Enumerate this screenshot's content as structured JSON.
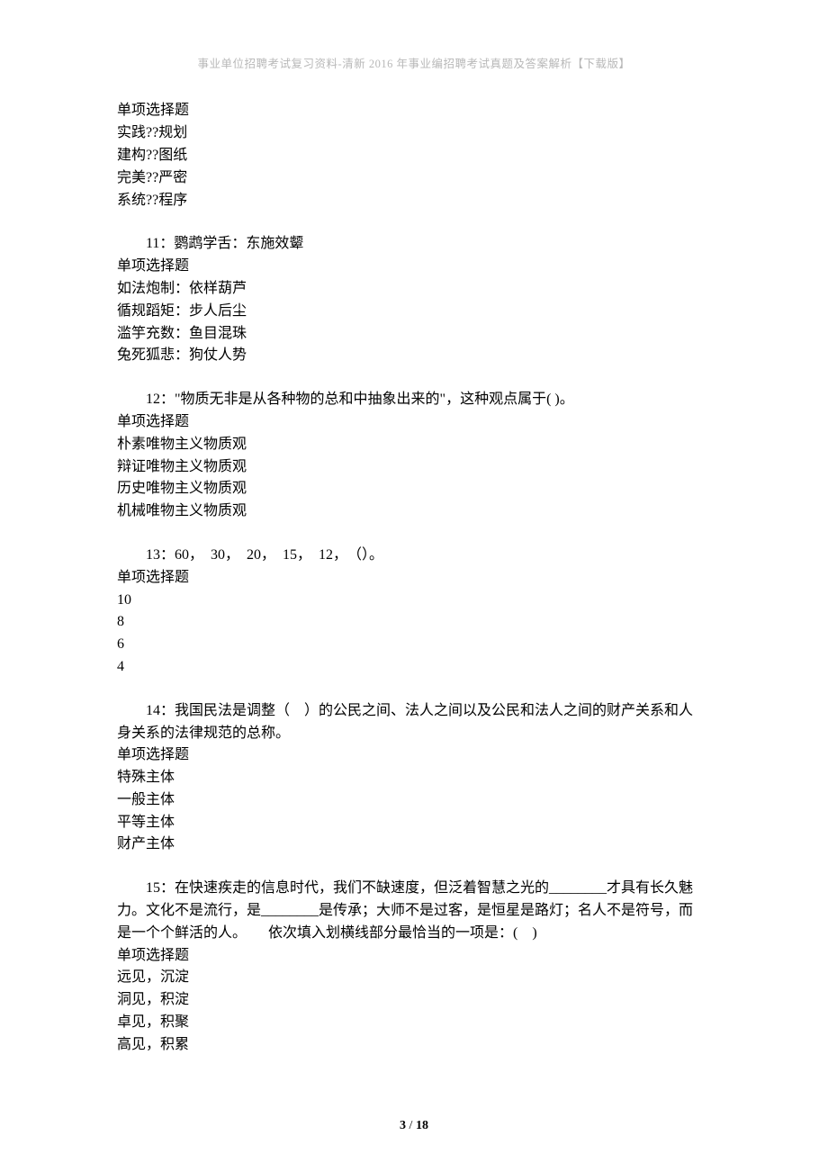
{
  "header": "事业单位招聘考试复习资料-清新 2016 年事业编招聘考试真题及答案解析【下载版】",
  "footer": {
    "current": "3",
    "sep": " / ",
    "total": "18"
  },
  "q10_tail": {
    "qtype": "单项选择题",
    "options": [
      "实践??规划",
      "建构??图纸",
      "完美??严密",
      "系统??程序"
    ]
  },
  "q11": {
    "stem": "11：鹦鹉学舌：东施效颦",
    "qtype": "单项选择题",
    "options": [
      "如法炮制：依样葫芦",
      "循规蹈矩：步人后尘",
      "滥竽充数：鱼目混珠",
      "兔死狐悲：狗仗人势"
    ]
  },
  "q12": {
    "stem": "12：\"物质无非是从各种物的总和中抽象出来的\"，这种观点属于( )。",
    "qtype": "单项选择题",
    "options": [
      "朴素唯物主义物质观",
      "辩证唯物主义物质观",
      "历史唯物主义物质观",
      "机械唯物主义物质观"
    ]
  },
  "q13": {
    "stem": "13：60，　30，　20，　15，　12，　（）。",
    "qtype": "单项选择题",
    "options": [
      "10",
      "8",
      "6",
      "4"
    ]
  },
  "q14": {
    "stem1": "14：我国民法是调整（　）的公民之间、法人之间以及公民和法人之间的财产关系和人",
    "stem2": "身关系的法律规范的总称。",
    "qtype": "单项选择题",
    "options": [
      "特殊主体",
      "一般主体",
      "平等主体",
      "财产主体"
    ]
  },
  "q15": {
    "stem1": "15：在快速疾走的信息时代，我们不缺速度，但泛着智慧之光的________才具有长久魅",
    "stem2": "力。文化不是流行，是________是传承；大师不是过客，是恒星是路灯；名人不是符号，而",
    "stem3": "是一个个鲜活的人。　　依次填入划横线部分最恰当的一项是：(　)",
    "qtype": "单项选择题",
    "options": [
      "远见，沉淀",
      "洞见，积淀",
      "卓见，积聚",
      "高见，积累"
    ]
  }
}
